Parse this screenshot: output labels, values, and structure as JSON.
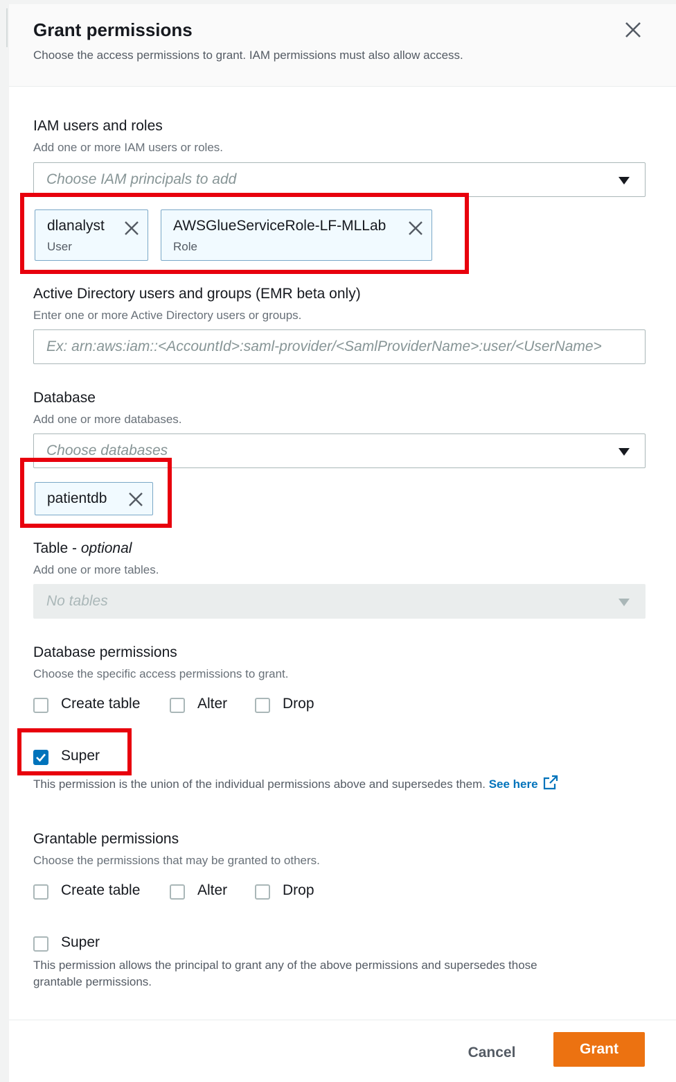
{
  "dialog": {
    "title": "Grant permissions",
    "subtitle": "Choose the access permissions to grant. IAM permissions must also allow access."
  },
  "iam": {
    "label": "IAM users and roles",
    "description": "Add one or more IAM users or roles.",
    "placeholder": "Choose IAM principals to add",
    "tokens": [
      {
        "name": "dlanalyst",
        "type": "User"
      },
      {
        "name": "AWSGlueServiceRole-LF-MLLab",
        "type": "Role"
      }
    ]
  },
  "active_directory": {
    "label": "Active Directory users and groups (EMR beta only)",
    "description": "Enter one or more Active Directory users or groups.",
    "placeholder": "Ex: arn:aws:iam::<AccountId>:saml-provider/<SamlProviderName>:user/<UserName>"
  },
  "database": {
    "label": "Database",
    "description": "Add one or more databases.",
    "placeholder": "Choose databases",
    "tokens": [
      {
        "name": "patientdb"
      }
    ]
  },
  "table": {
    "label": "Table - ",
    "label_optional": "optional",
    "description": "Add one or more tables.",
    "placeholder": "No tables"
  },
  "db_permissions": {
    "label": "Database permissions",
    "description": "Choose the specific access permissions to grant.",
    "options": [
      {
        "label": "Create table",
        "checked": false
      },
      {
        "label": "Alter",
        "checked": false
      },
      {
        "label": "Drop",
        "checked": false
      }
    ],
    "super": {
      "label": "Super",
      "checked": true
    },
    "super_help": "This permission is the union of the individual permissions above and supersedes them.",
    "see_here": "See here"
  },
  "grantable": {
    "label": "Grantable permissions",
    "description": "Choose the permissions that may be granted to others.",
    "options": [
      {
        "label": "Create table",
        "checked": false
      },
      {
        "label": "Alter",
        "checked": false
      },
      {
        "label": "Drop",
        "checked": false
      }
    ],
    "super": {
      "label": "Super",
      "checked": false
    },
    "super_help_line1": "This permission allows the principal to grant any of the above permissions and supersedes those",
    "super_help_line2": "grantable permissions."
  },
  "footer": {
    "cancel": "Cancel",
    "grant": "Grant"
  },
  "colors": {
    "accent": "#0073bb",
    "primary_button": "#ec7211",
    "highlight": "#e8000d"
  }
}
